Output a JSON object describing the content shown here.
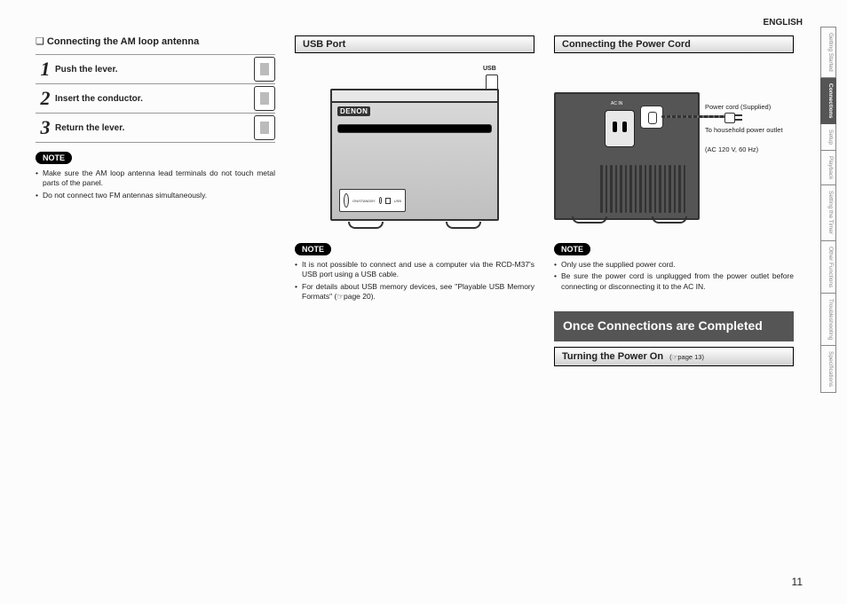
{
  "language": "ENGLISH",
  "page_number": "11",
  "left": {
    "heading": "Connecting the AM loop antenna",
    "steps": [
      {
        "num": "1",
        "text": "Push the lever."
      },
      {
        "num": "2",
        "text": "Insert the conductor."
      },
      {
        "num": "3",
        "text": "Return the lever."
      }
    ],
    "note_label": "NOTE",
    "notes": [
      "Make sure the AM loop antenna lead terminals do not touch metal parts of the panel.",
      "Do not connect two FM antennas simultaneously."
    ]
  },
  "mid": {
    "heading": "USB Port",
    "brand": "DENON",
    "usb_label": "USB",
    "hp_label": "ON/STANDBY",
    "usb_port_label": "USB",
    "note_label": "NOTE",
    "notes": [
      "It is not possible to connect and use a computer via the RCD-M37's USB port using a USB cable.",
      "For details about USB memory devices, see \"Playable USB Memory Formats\" (☞page 20)."
    ]
  },
  "right": {
    "heading": "Connecting the Power Cord",
    "ac_label": "AC IN",
    "cord_supplied": "Power cord (Supplied)",
    "to_outlet": "To household power outlet",
    "ac_rating": "(AC 120 V, 60 Hz)",
    "note_label": "NOTE",
    "notes": [
      "Only use the supplied power cord.",
      "Be sure the power cord is unplugged from the power outlet before connecting or disconnecting it to the AC IN."
    ],
    "big_heading": "Once Connections are Completed",
    "sub_heading": "Turning the Power On",
    "sub_page_ref": "(☞page 13)"
  },
  "tabs": [
    {
      "label": "Getting Started",
      "active": false
    },
    {
      "label": "Connections",
      "active": true
    },
    {
      "label": "Setup",
      "active": false
    },
    {
      "label": "Playback",
      "active": false
    },
    {
      "label": "Setting the Timer",
      "active": false
    },
    {
      "label": "Other Functions",
      "active": false
    },
    {
      "label": "Troubleshooting",
      "active": false
    },
    {
      "label": "Specifications",
      "active": false
    }
  ]
}
